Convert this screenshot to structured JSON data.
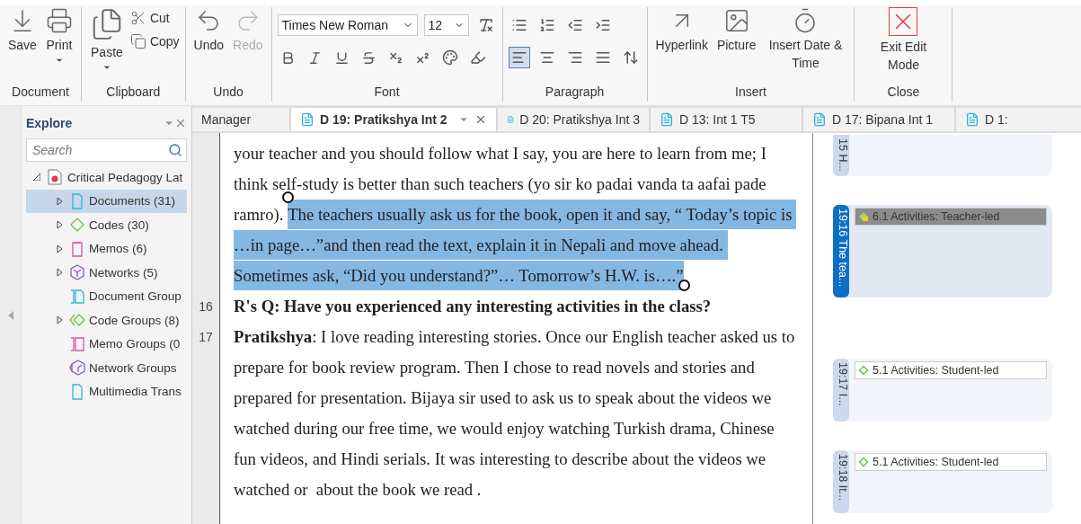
{
  "ribbon": {
    "groups": [
      {
        "label": "Document",
        "kind": "buttons",
        "buttons": [
          {
            "label": "Save",
            "kind": "save",
            "disabled": false,
            "dropdown": false
          },
          {
            "label": "Print",
            "kind": "print",
            "disabled": false,
            "dropdown": true
          }
        ]
      },
      {
        "label": "Clipboard",
        "kind": "clipboard",
        "buttons": [
          {
            "label": "Paste",
            "kind": "paste",
            "disabled": false,
            "dropdown": true
          }
        ],
        "small": [
          {
            "label": "Cut",
            "kind": "cut"
          },
          {
            "label": "Copy",
            "kind": "copy"
          }
        ]
      },
      {
        "label": "Undo",
        "kind": "buttons",
        "buttons": [
          {
            "label": "Undo",
            "kind": "undo",
            "disabled": false,
            "dropdown": false
          },
          {
            "label": "Redo",
            "kind": "redo",
            "disabled": true,
            "dropdown": false
          }
        ]
      },
      {
        "label": "Font",
        "kind": "font",
        "font_name": "Times New Roman",
        "font_size": "12"
      },
      {
        "label": "Paragraph",
        "kind": "paragraph",
        "alignments": [
          {
            "kind": "left",
            "selected": true
          },
          {
            "kind": "center",
            "selected": false
          },
          {
            "kind": "right",
            "selected": false
          },
          {
            "kind": "justify",
            "selected": false
          }
        ]
      },
      {
        "label": "Insert",
        "kind": "buttons",
        "buttons": [
          {
            "label": "Hyperlink",
            "kind": "link",
            "disabled": false,
            "dropdown": false
          },
          {
            "label": "Picture",
            "kind": "picture",
            "disabled": false,
            "dropdown": false
          },
          {
            "label": "Insert Date & Time",
            "kind": "clock",
            "disabled": false,
            "dropdown": false
          }
        ]
      },
      {
        "label": "Close",
        "kind": "buttons",
        "buttons": [
          {
            "label": "Exit Edit Mode",
            "kind": "exit",
            "disabled": false,
            "dropdown": false
          }
        ]
      }
    ]
  },
  "explore": {
    "title": "Explore",
    "search": {
      "placeholder": "Search"
    },
    "root": {
      "label": "Critical Pedagogy Lat",
      "expanded": true,
      "children": [
        {
          "label": "Documents (31)",
          "kind": "documents",
          "expandable": true,
          "selected": true
        },
        {
          "label": "Codes (30)",
          "kind": "codes",
          "expandable": true,
          "selected": false
        },
        {
          "label": "Memos (6)",
          "kind": "memos",
          "expandable": true,
          "selected": false
        },
        {
          "label": "Networks (5)",
          "kind": "networks",
          "expandable": true,
          "selected": false
        },
        {
          "label": "Document Group",
          "kind": "document-groups",
          "expandable": false,
          "selected": false
        },
        {
          "label": "Code Groups (8)",
          "kind": "code-groups",
          "expandable": true,
          "selected": false
        },
        {
          "label": "Memo Groups (0",
          "kind": "memo-groups",
          "expandable": false,
          "selected": false
        },
        {
          "label": "Network Groups",
          "kind": "network-groups",
          "expandable": false,
          "selected": false
        },
        {
          "label": "Multimedia Trans",
          "kind": "documents",
          "expandable": false,
          "selected": false
        }
      ]
    }
  },
  "tabs": [
    {
      "label": "Manager",
      "kind": "cut",
      "selected": false
    },
    {
      "label": "D 19: Pratikshya Int 2",
      "kind": "document",
      "selected": true
    },
    {
      "label": "D 20: Pratikshya Int 3",
      "kind": "document",
      "selected": false
    },
    {
      "label": "D 13: Int 1 T5",
      "kind": "document",
      "selected": false
    },
    {
      "label": "D 17: Bipana Int 1",
      "kind": "document",
      "selected": false
    },
    {
      "label": "D 1:",
      "kind": "document",
      "selected": false
    }
  ],
  "document": {
    "paragraphs": [
      {
        "kind": "answer",
        "segments": [
          {
            "text": "your teacher and you should follow what I say, you are here to learn from me; I think self-study is better than such teachers (yo sir ko padai vanda ta aafai pade ramro). ",
            "selected": false
          },
          {
            "text": "The teachers usually ask us for the book, open it and say, “ Today’s topic is …in page…”and then read the text, explain it in Nepali and move ahead. Sometimes ask, “Did you understand?”… Tomorrow’s H.W. is….”",
            "selected": true
          }
        ]
      },
      {
        "number": "16",
        "kind": "question",
        "segments": [
          {
            "text": "R's Q: Have you experienced any interesting activities in the class?",
            "selected": false
          }
        ]
      },
      {
        "number": "17",
        "kind": "answer",
        "segments": [
          {
            "text": "**Pratikshya**: I love reading interesting stories. Once our English teacher asked us to prepare for book review program. Then I chose to read novels and stories and prepared for presentation. Bijaya sir used to ask us to speak about the videos we watched during our free time, we would enjoy watching Turkish drama, Chinese fun videos, and Hindi serials. It was interesting to describe about the videos we watched or  about the book we read .",
            "selected": false
          }
        ]
      }
    ]
  },
  "margin": {
    "quotations": [
      {
        "label": "15 H...",
        "selected": false
      },
      {
        "label": "19:16 The tea...",
        "selected": true,
        "codes": [
          {
            "label": "6.1 Activities: Teacher-led",
            "kind": "commented",
            "selected": true
          }
        ]
      },
      {
        "label": "19:17 I...",
        "selected": false,
        "codes": [
          {
            "label": "5.1 Activities: Student-led",
            "kind": "plain",
            "selected": false
          }
        ]
      },
      {
        "label": "19:18 It...",
        "selected": false,
        "codes": [
          {
            "label": "5.1 Activities: Student-led",
            "kind": "plain",
            "selected": false
          }
        ]
      }
    ]
  }
}
